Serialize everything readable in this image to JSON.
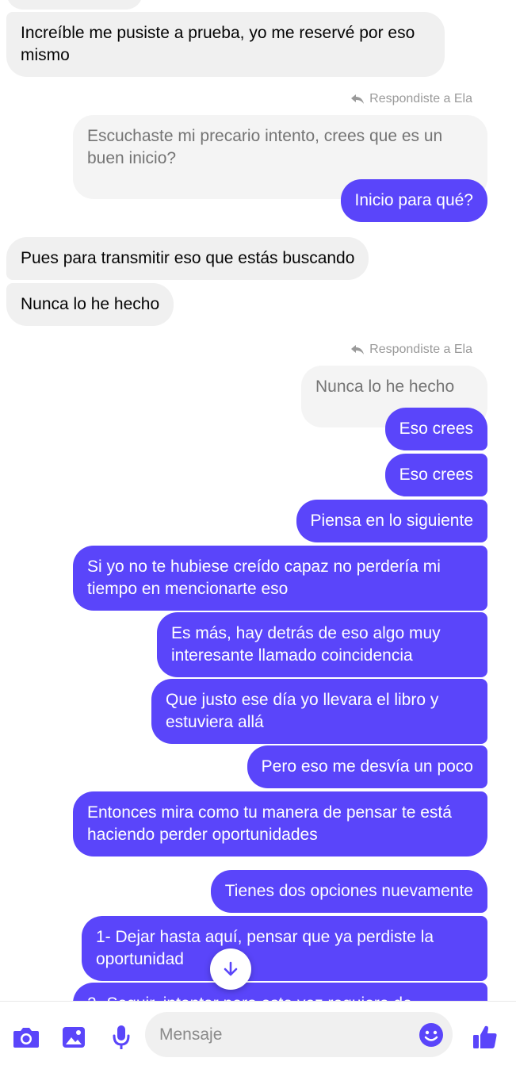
{
  "messages": [
    {
      "id": "m0",
      "text": "Increíble me pusiste a prueba, yo me reservé por eso mismo"
    },
    {
      "id": "m1",
      "reply_note": "Respondiste a Ela",
      "quoted": "Escuchaste mi precario intento, crees que es un buen inicio?",
      "text": "Inicio para qué?"
    },
    {
      "id": "m2",
      "text": "Pues para transmitir eso que estás buscando"
    },
    {
      "id": "m3",
      "text": "Nunca lo he hecho"
    },
    {
      "id": "m4",
      "reply_note": "Respondiste a Ela",
      "quoted": "Nunca lo he hecho",
      "text": "Eso crees"
    },
    {
      "id": "m5",
      "text": "Eso crees"
    },
    {
      "id": "m6",
      "text": "Piensa en lo siguiente"
    },
    {
      "id": "m7",
      "text": "Si yo no te hubiese creído capaz no perdería mi tiempo en mencionarte eso"
    },
    {
      "id": "m8",
      "text": "Es más, hay detrás de eso algo muy interesante llamado coincidencia"
    },
    {
      "id": "m9",
      "text": "Que justo ese día yo llevara el libro y estuviera allá"
    },
    {
      "id": "m10",
      "text": "Pero eso me desvía un poco"
    },
    {
      "id": "m11",
      "text": "Entonces mira como tu manera de pensar te está haciendo perder oportunidades"
    },
    {
      "id": "m12",
      "text": "Tienes dos opciones nuevamente"
    },
    {
      "id": "m13",
      "text": "1- Dejar hasta aquí, pensar que ya perdiste la oportunidad"
    },
    {
      "id": "m14",
      "text": "2- Seguir, intentar pero esta vez requiere de"
    }
  ],
  "composer": {
    "placeholder": "Mensaje",
    "icons": [
      "camera-icon",
      "gallery-icon",
      "microphone-icon",
      "emoji-icon",
      "thumbs-up-icon"
    ]
  },
  "colors": {
    "sent": "#5a45fa",
    "received": "#f0f0f0",
    "accent": "#5a45fa"
  }
}
